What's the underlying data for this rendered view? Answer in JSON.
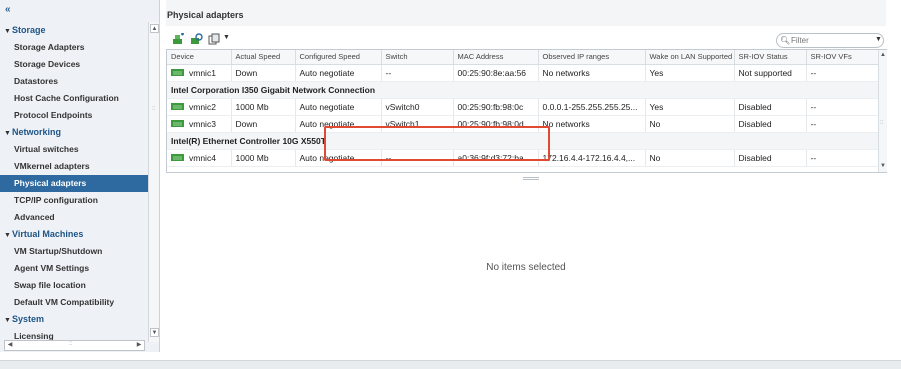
{
  "sidebar": {
    "collapse_label": "«",
    "categories": [
      {
        "label": "Storage",
        "items": [
          {
            "label": "Storage Adapters"
          },
          {
            "label": "Storage Devices"
          },
          {
            "label": "Datastores"
          },
          {
            "label": "Host Cache Configuration"
          },
          {
            "label": "Protocol Endpoints"
          }
        ]
      },
      {
        "label": "Networking",
        "items": [
          {
            "label": "Virtual switches"
          },
          {
            "label": "VMkernel adapters"
          },
          {
            "label": "Physical adapters",
            "selected": true
          },
          {
            "label": "TCP/IP configuration"
          },
          {
            "label": "Advanced"
          }
        ]
      },
      {
        "label": "Virtual Machines",
        "items": [
          {
            "label": "VM Startup/Shutdown"
          },
          {
            "label": "Agent VM Settings"
          },
          {
            "label": "Swap file location"
          },
          {
            "label": "Default VM Compatibility"
          }
        ]
      },
      {
        "label": "System",
        "items": [
          {
            "label": "Licensing"
          }
        ]
      }
    ]
  },
  "main": {
    "title": "Physical adapters",
    "toolbar": {
      "icons": [
        "add-network-icon",
        "refresh-adapter-icon",
        "copy-icon"
      ]
    },
    "filter": {
      "placeholder": "Filter"
    },
    "columns": [
      "Device",
      "Actual Speed",
      "Configured Speed",
      "Switch",
      "MAC Address",
      "Observed IP ranges",
      "Wake on LAN Supported",
      "SR-IOV Status",
      "SR-IOV VFs"
    ],
    "rows": [
      {
        "type": "row",
        "cells": [
          "vmnic1",
          "Down",
          "Auto negotiate",
          "--",
          "00:25:90:8e:aa:56",
          "No networks",
          "Yes",
          "Not supported",
          "--"
        ]
      },
      {
        "type": "group",
        "label": "Intel Corporation I350 Gigabit Network Connection"
      },
      {
        "type": "row",
        "cells": [
          "vmnic2",
          "1000 Mb",
          "Auto negotiate",
          "vSwitch0",
          "00:25:90:fb:98:0c",
          "0.0.0.1-255.255.255.25...",
          "Yes",
          "Disabled",
          "--"
        ]
      },
      {
        "type": "row",
        "cells": [
          "vmnic3",
          "Down",
          "Auto negotiate",
          "vSwitch1",
          "00:25:90:fb:98:0d",
          "No networks",
          "No",
          "Disabled",
          "--"
        ]
      },
      {
        "type": "group",
        "label": "Intel(R) Ethernet Controller 10G X550T"
      },
      {
        "type": "row",
        "cells": [
          "vmnic4",
          "1000 Mb",
          "Auto negotiate",
          "--",
          "a0:36:9f:d3:72:ba",
          "172.16.4.4-172.16.4.4,...",
          "No",
          "Disabled",
          "--"
        ]
      }
    ],
    "details_empty": "No items selected"
  },
  "colors": {
    "accent": "#2e6aa0",
    "nav_category": "#1f5486",
    "highlight_box": "#e04a33",
    "nic_icon": "#3c9a3c"
  }
}
